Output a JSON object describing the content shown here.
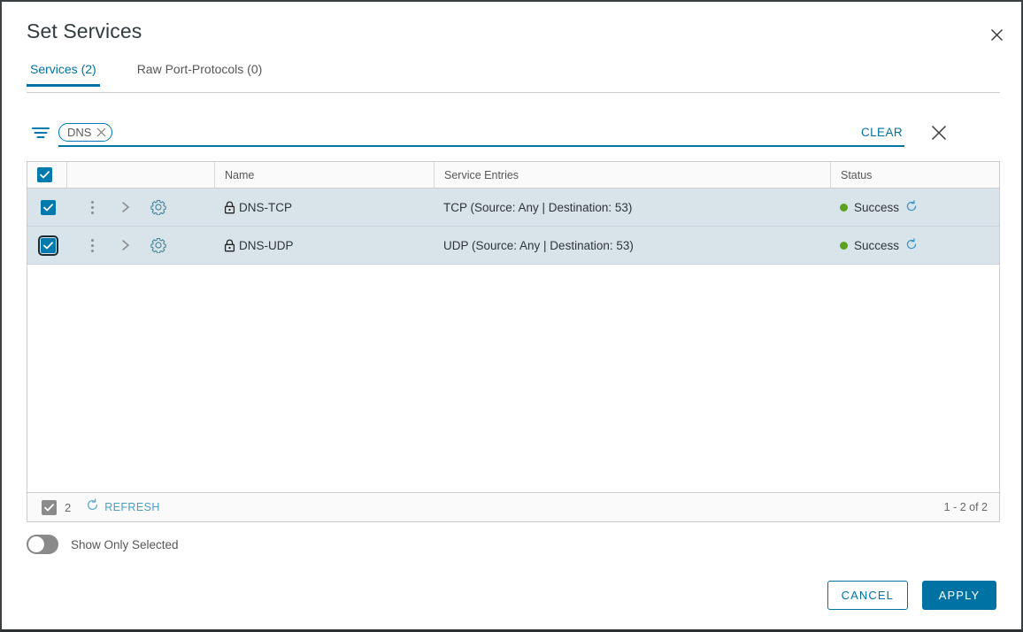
{
  "dialog": {
    "title": "Set Services",
    "close_icon": "close-icon"
  },
  "tabs": [
    {
      "label": "Services (2)",
      "active": true
    },
    {
      "label": "Raw Port-Protocols (0)",
      "active": false
    }
  ],
  "filter": {
    "icon": "filter-icon",
    "chip_label": "DNS",
    "chip_remove_icon": "close-icon",
    "clear_label": "CLEAR",
    "close_icon": "close-icon"
  },
  "grid": {
    "columns": [
      "",
      "",
      "Name",
      "Service Entries",
      "Status"
    ],
    "header_select_all_checked": true,
    "rows": [
      {
        "selected": true,
        "focused": false,
        "name": "DNS-TCP",
        "service_entries": "TCP (Source: Any | Destination: 53)",
        "status": "Success",
        "status_color": "#5aa220"
      },
      {
        "selected": true,
        "focused": true,
        "name": "DNS-UDP",
        "service_entries": "UDP (Source: Any | Destination: 53)",
        "status": "Success",
        "status_color": "#5aa220"
      }
    ],
    "footer": {
      "selected_count": "2",
      "refresh_label": "REFRESH",
      "pager": "1 - 2 of 2"
    }
  },
  "show_only_selected": {
    "label": "Show Only Selected",
    "enabled": false
  },
  "buttons": {
    "cancel": "CANCEL",
    "apply": "APPLY"
  },
  "colors": {
    "accent": "#0072a3",
    "selected_row": "#d9e4ea",
    "success": "#5aa220"
  }
}
